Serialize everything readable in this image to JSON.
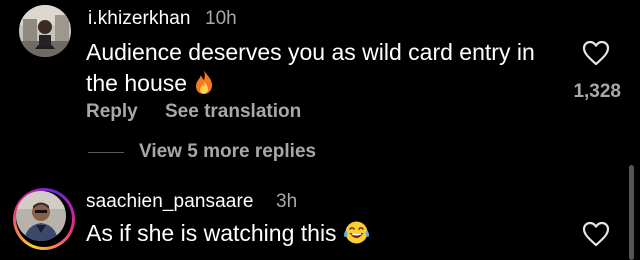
{
  "comments": [
    {
      "username": "i.khizerkhan",
      "time": "10h",
      "text_line1": "Audience deserves you as wild card entry in",
      "text_line2": "the house",
      "emoji_icon": "fire-emoji",
      "reply_label": "Reply",
      "translate_label": "See translation",
      "like_count": "1,328",
      "more_replies_label": "View 5 more replies"
    },
    {
      "username": "saachien_pansaare",
      "time": "3h",
      "text": "As if she is watching this",
      "emoji_icon": "laughing-tears-emoji",
      "has_story_ring": true
    }
  ],
  "colors": {
    "background": "#000000",
    "primary_text": "#ffffff",
    "secondary_text": "#a8a8a8",
    "story_ring": [
      "#f9ce34",
      "#ee2a7b",
      "#6228d7"
    ]
  }
}
